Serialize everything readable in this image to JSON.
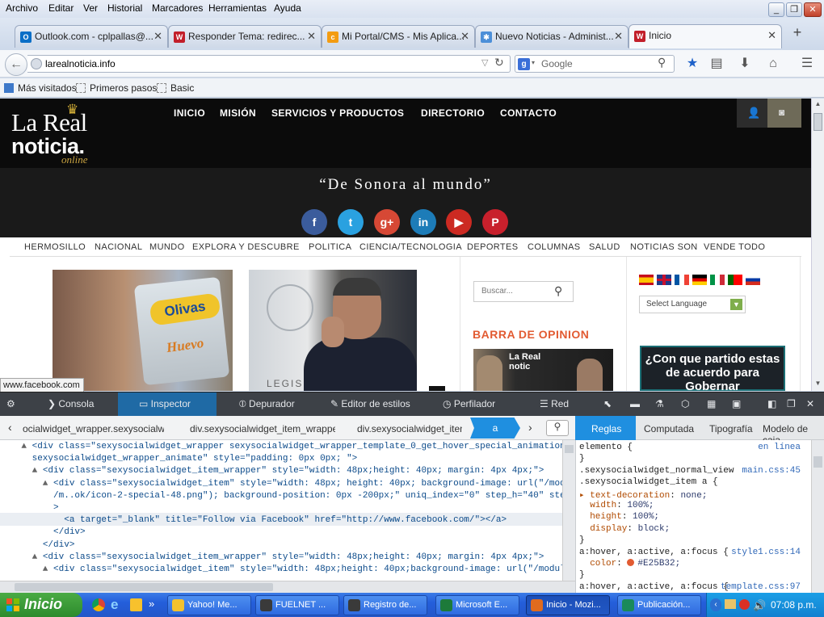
{
  "menubar": {
    "items": [
      "Archivo",
      "Editar",
      "Ver",
      "Historial",
      "Marcadores",
      "Herramientas",
      "Ayuda"
    ]
  },
  "tabs": [
    {
      "label": "Outlook.com - cplpallas@...",
      "icon": "outlook-icon",
      "color": "#0b6fc7"
    },
    {
      "label": "Responder Tema: redirec...",
      "icon": "forum-icon",
      "color": "#c21f2a"
    },
    {
      "label": "Mi Portal/CMS - Mis Aplica...",
      "icon": "cms-icon",
      "color": "#f39c12"
    },
    {
      "label": "Nuevo Noticias - Administ...",
      "icon": "joomla-icon",
      "color": "#4c8fd8"
    },
    {
      "label": "Inicio",
      "icon": "site-icon",
      "color": "#c21f2a",
      "active": true
    }
  ],
  "navbar": {
    "url": "larealnoticia.info",
    "search_placeholder": "Google"
  },
  "bookmarks": [
    "Más visitados",
    "Primeros pasos",
    "Basic"
  ],
  "site": {
    "logo_line1": "La Real",
    "logo_line2": "noticia.",
    "logo_line3": "online",
    "nav": [
      "INICIO",
      "MISIÓN",
      "SERVICIOS Y PRODUCTOS",
      "DIRECTORIO",
      "CONTACTO"
    ],
    "slogan": "“De Sonora al mundo”",
    "social": [
      {
        "label": "f",
        "color": "#3b5c9c",
        "icon": "facebook-icon"
      },
      {
        "label": "t",
        "color": "#2aa1e0",
        "icon": "twitter-icon"
      },
      {
        "label": "g+",
        "color": "#d64835",
        "icon": "google-plus-icon"
      },
      {
        "label": "in",
        "color": "#1d7cb8",
        "icon": "linkedin-icon"
      },
      {
        "label": "▶",
        "color": "#cc2a22",
        "icon": "youtube-icon"
      },
      {
        "label": "P",
        "color": "#c8202c",
        "icon": "pinterest-icon"
      }
    ],
    "categories": [
      "HERMOSILLO",
      "NACIONAL",
      "MUNDO",
      "EXPLORA Y DESCUBRE",
      "POLITICA",
      "CIENCIA/TECNOLOGIA",
      "DEPORTES",
      "COLUMNAS",
      "SALUD",
      "NOTICIAS SON",
      "VENDE TODO"
    ],
    "product_brand": "Olivas",
    "product_word": "Huevo",
    "photo_caption": "LEGIS",
    "search_placeholder": "Buscar...",
    "barra_title": "BARRA DE OPINION",
    "opinion_logo": "La Real notic",
    "select_language": "Select Language",
    "poll_text": "¿Con que partido estas de acuerdo para Gobernar",
    "status_tooltip": "www.facebook.com",
    "flags": [
      "#c60b1e",
      "#1f3b8a",
      "#0055a4",
      "#000000",
      "#009246",
      "#006600",
      "#0039a6"
    ]
  },
  "devtools": {
    "tabs": [
      "Consola",
      "Inspector",
      "Depurador",
      "Editor de estilos",
      "Perfilador",
      "Red"
    ],
    "breadcrumbs": [
      "ocialwidget_wrapper.sexysocialw...",
      "div.sexysocialwidget_item_wrapper",
      "div.sexysocialwidget_item",
      "a"
    ],
    "side_tabs": [
      "Reglas",
      "Computada",
      "Tipografía",
      "Modelo de caja"
    ],
    "markup": [
      {
        "indent": "    ▲ ",
        "html": "<div class=\"sexysocialwidget_wrapper sexysocialwidget_wrapper_template_0_get_hover_special_animation"
      },
      {
        "indent": "      ",
        "html": "sexysocialwidget_wrapper_animate\" style=\"padding: 0px 0px; \">"
      },
      {
        "indent": "      ▲ ",
        "html": "<div class=\"sexysocialwidget_item_wrapper\" style=\"width: 48px;height: 40px; margin: 4px 4px;\">"
      },
      {
        "indent": "        ▲ ",
        "html": "<div class=\"sexysocialwidget_item\" style=\"width: 48px; height: 40px; background-image: url(\"/modules"
      },
      {
        "indent": "          ",
        "html": "/m..ok/icon-2-special-48.png\"); background-position: 0px -200px;\" uniq_index=\"0\" step_h=\"40\" steps=\"5\""
      },
      {
        "indent": "          ",
        "html": ">"
      },
      {
        "indent": "            ",
        "html": "<a target=\"_blank\" title=\"Follow via Facebook\" href=\"http://www.facebook.com/\"></a>"
      },
      {
        "indent": "          ",
        "html": "</div>"
      },
      {
        "indent": "        ",
        "html": "</div>"
      },
      {
        "indent": "      ▲ ",
        "html": "<div class=\"sexysocialwidget_item_wrapper\" style=\"width: 48px;height: 40px; margin: 4px 4px;\">"
      },
      {
        "indent": "        ▲ ",
        "html": "<div class=\"sexysocialwidget_item\" style=\"width: 48px;height: 40px;background-image: url(\"/modules"
      }
    ],
    "rules": [
      {
        "selector": "elemento {",
        "source": "en línea"
      },
      {
        "selector": "}"
      },
      {
        "selector": ".sexysocialwidget_normal_view",
        "source": "main.css:45"
      },
      {
        "selector": ".sexysocialwidget_item a {"
      },
      {
        "prop": "text-decoration",
        "value": "none;"
      },
      {
        "prop": "width",
        "value": "100%;"
      },
      {
        "prop": "height",
        "value": "100%;"
      },
      {
        "prop": "display",
        "value": "block;"
      },
      {
        "selector": "}"
      },
      {
        "selector": "a:hover, a:active, a:focus {",
        "source": "style1.css:14"
      },
      {
        "prop": "color",
        "value": "#E25B32;",
        "swatch": "#E25B32"
      },
      {
        "selector": "}"
      },
      {
        "selector": "a:hover, a:active, a:focus {",
        "source": "template.css:97"
      }
    ]
  },
  "taskbar": {
    "start": "Inicio",
    "items": [
      {
        "label": "Yahoo! Me...",
        "color": "#f2c12e"
      },
      {
        "label": "FUELNET ...",
        "color": "#3a3a3a"
      },
      {
        "label": "Registro de...",
        "color": "#3a3a3a"
      },
      {
        "label": "Microsoft E...",
        "color": "#1d7a3a"
      },
      {
        "label": "Inicio - Mozi...",
        "color": "#e06b1e",
        "active": true
      },
      {
        "label": "Publicación...",
        "color": "#1a8a5a"
      }
    ],
    "clock": "07:08 p.m."
  }
}
